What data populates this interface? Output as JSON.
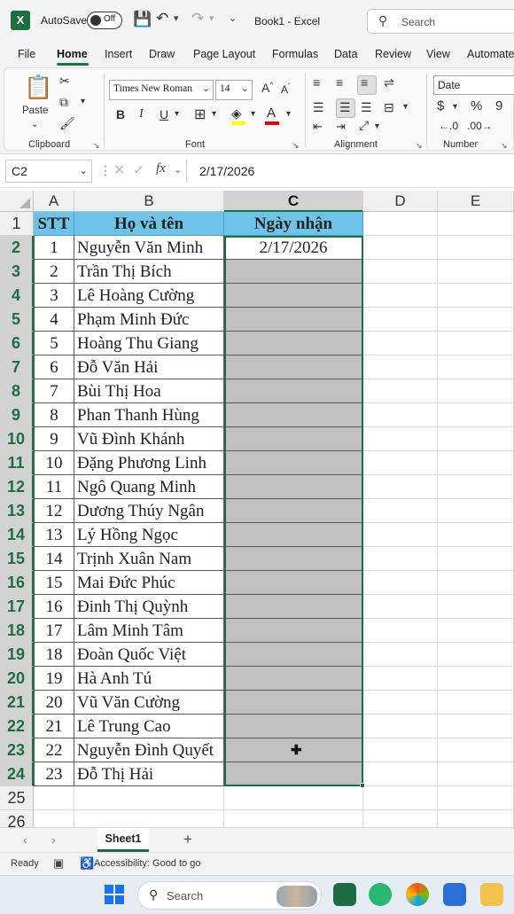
{
  "titlebar": {
    "autosave_label": "AutoSave",
    "autosave_state": "Off",
    "doc_title": "Book1 - Excel",
    "search_placeholder": "Search",
    "icons": [
      "save-icon",
      "undo-icon",
      "redo-icon"
    ]
  },
  "tabs": [
    "File",
    "Home",
    "Insert",
    "Draw",
    "Page Layout",
    "Formulas",
    "Data",
    "Review",
    "View",
    "Automate"
  ],
  "active_tab": "Home",
  "ribbon": {
    "clipboard": {
      "paste_label": "Paste",
      "group_label": "Clipboard"
    },
    "font": {
      "font_name": "Times New Roman",
      "font_size": "14",
      "group_label": "Font",
      "bold": "B",
      "italic": "I",
      "underline": "U"
    },
    "alignment": {
      "group_label": "Alignment"
    },
    "number": {
      "format": "Date",
      "currency": "$",
      "percent": "%",
      "comma": "9",
      "group_label": "Number"
    }
  },
  "formula_bar": {
    "name_box": "C2",
    "fx_label": "fx",
    "value": "2/17/2026"
  },
  "columns": [
    "A",
    "B",
    "C",
    "D",
    "E"
  ],
  "selected_column": "C",
  "header_row": {
    "a": "STT",
    "b": "Họ và tên",
    "c": "Ngày nhận"
  },
  "rows": [
    {
      "stt": "1",
      "name": "Nguyễn Văn Minh",
      "date": "2/17/2026"
    },
    {
      "stt": "2",
      "name": "Trần Thị Bích",
      "date": ""
    },
    {
      "stt": "3",
      "name": "Lê Hoàng Cường",
      "date": ""
    },
    {
      "stt": "4",
      "name": "Phạm Minh Đức",
      "date": ""
    },
    {
      "stt": "5",
      "name": "Hoàng Thu Giang",
      "date": ""
    },
    {
      "stt": "6",
      "name": "Đỗ Văn Hải",
      "date": ""
    },
    {
      "stt": "7",
      "name": "Bùi Thị Hoa",
      "date": ""
    },
    {
      "stt": "8",
      "name": "Phan Thanh Hùng",
      "date": ""
    },
    {
      "stt": "9",
      "name": "Vũ Đình Khánh",
      "date": ""
    },
    {
      "stt": "10",
      "name": "Đặng Phương Linh",
      "date": ""
    },
    {
      "stt": "11",
      "name": "Ngô Quang Minh",
      "date": ""
    },
    {
      "stt": "12",
      "name": "Dương Thúy Ngân",
      "date": ""
    },
    {
      "stt": "13",
      "name": "Lý Hồng Ngọc",
      "date": ""
    },
    {
      "stt": "14",
      "name": "Trịnh Xuân Nam",
      "date": ""
    },
    {
      "stt": "15",
      "name": "Mai Đức Phúc",
      "date": ""
    },
    {
      "stt": "16",
      "name": "Đinh Thị Quỳnh",
      "date": ""
    },
    {
      "stt": "17",
      "name": "Lâm Minh Tâm",
      "date": ""
    },
    {
      "stt": "18",
      "name": "Đoàn Quốc Việt",
      "date": ""
    },
    {
      "stt": "19",
      "name": "Hà Anh Tú",
      "date": ""
    },
    {
      "stt": "20",
      "name": "Vũ Văn Cường",
      "date": ""
    },
    {
      "stt": "21",
      "name": "Lê Trung Cao",
      "date": ""
    },
    {
      "stt": "22",
      "name": "Nguyễn Đình Quyết",
      "date": ""
    },
    {
      "stt": "23",
      "name": "Đỗ Thị Hải",
      "date": ""
    }
  ],
  "row_numbers": [
    "1",
    "2",
    "3",
    "4",
    "5",
    "6",
    "7",
    "8",
    "9",
    "10",
    "11",
    "12",
    "13",
    "14",
    "15",
    "16",
    "17",
    "18",
    "19",
    "20",
    "21",
    "22",
    "23",
    "24",
    "25",
    "26"
  ],
  "sheets": {
    "active": "Sheet1",
    "add_label": "+"
  },
  "status": {
    "ready": "Ready",
    "accessibility": "Accessibility: Good to go"
  },
  "taskbar": {
    "search_placeholder": "Search"
  },
  "colors": {
    "excel_green": "#1d6f42",
    "header_fill": "#6fc3e8",
    "selection_shade": "#c0c0c0"
  }
}
